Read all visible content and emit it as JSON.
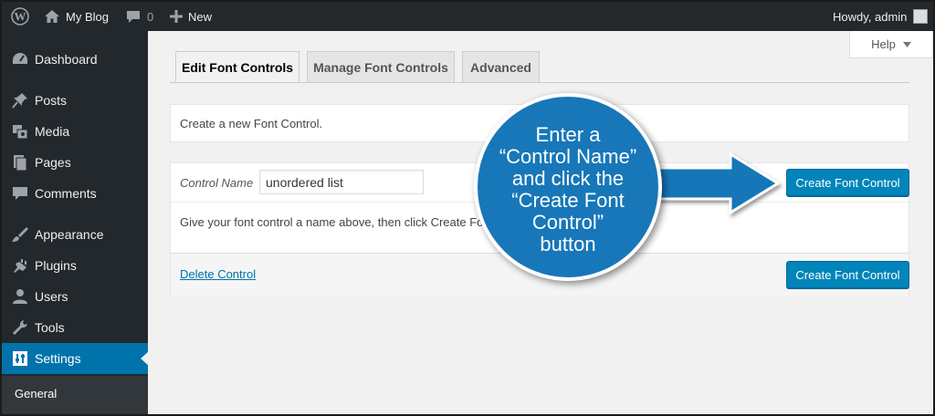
{
  "admin_bar": {
    "site_name": "My Blog",
    "comment_count": "0",
    "new_label": "New",
    "greeting": "Howdy, admin"
  },
  "sidebar": {
    "items": [
      {
        "label": "Dashboard",
        "icon": "dashboard-icon"
      },
      {
        "label": "Posts",
        "icon": "pin-icon"
      },
      {
        "label": "Media",
        "icon": "media-icon"
      },
      {
        "label": "Pages",
        "icon": "pages-icon"
      },
      {
        "label": "Comments",
        "icon": "comment-icon"
      },
      {
        "label": "Appearance",
        "icon": "brush-icon"
      },
      {
        "label": "Plugins",
        "icon": "plug-icon"
      },
      {
        "label": "Users",
        "icon": "user-icon"
      },
      {
        "label": "Tools",
        "icon": "wrench-icon"
      },
      {
        "label": "Settings",
        "icon": "settings-icon",
        "active": true
      }
    ],
    "submenu": [
      "General"
    ]
  },
  "help": {
    "label": "Help"
  },
  "tabs": [
    {
      "label": "Edit Font Controls",
      "active": true
    },
    {
      "label": "Manage Font Controls"
    },
    {
      "label": "Advanced"
    }
  ],
  "notice": {
    "text": "Create a new Font Control."
  },
  "form": {
    "control_name_label": "Control Name",
    "control_name_value": "unordered list",
    "create_button_label": "Create Font Control",
    "instructions": "Give your font control a name above, then click Create Font Control.",
    "delete_link": "Delete Control",
    "create_button_label_bottom": "Create Font Control"
  },
  "callout": {
    "lines": [
      "Enter a",
      "“Control Name”",
      "and click the",
      "“Create Font",
      "Control”",
      "button"
    ]
  },
  "colors": {
    "admin_bar": "#23282d",
    "accent": "#0073aa",
    "button": "#0085ba",
    "callout": "#1777b8"
  }
}
